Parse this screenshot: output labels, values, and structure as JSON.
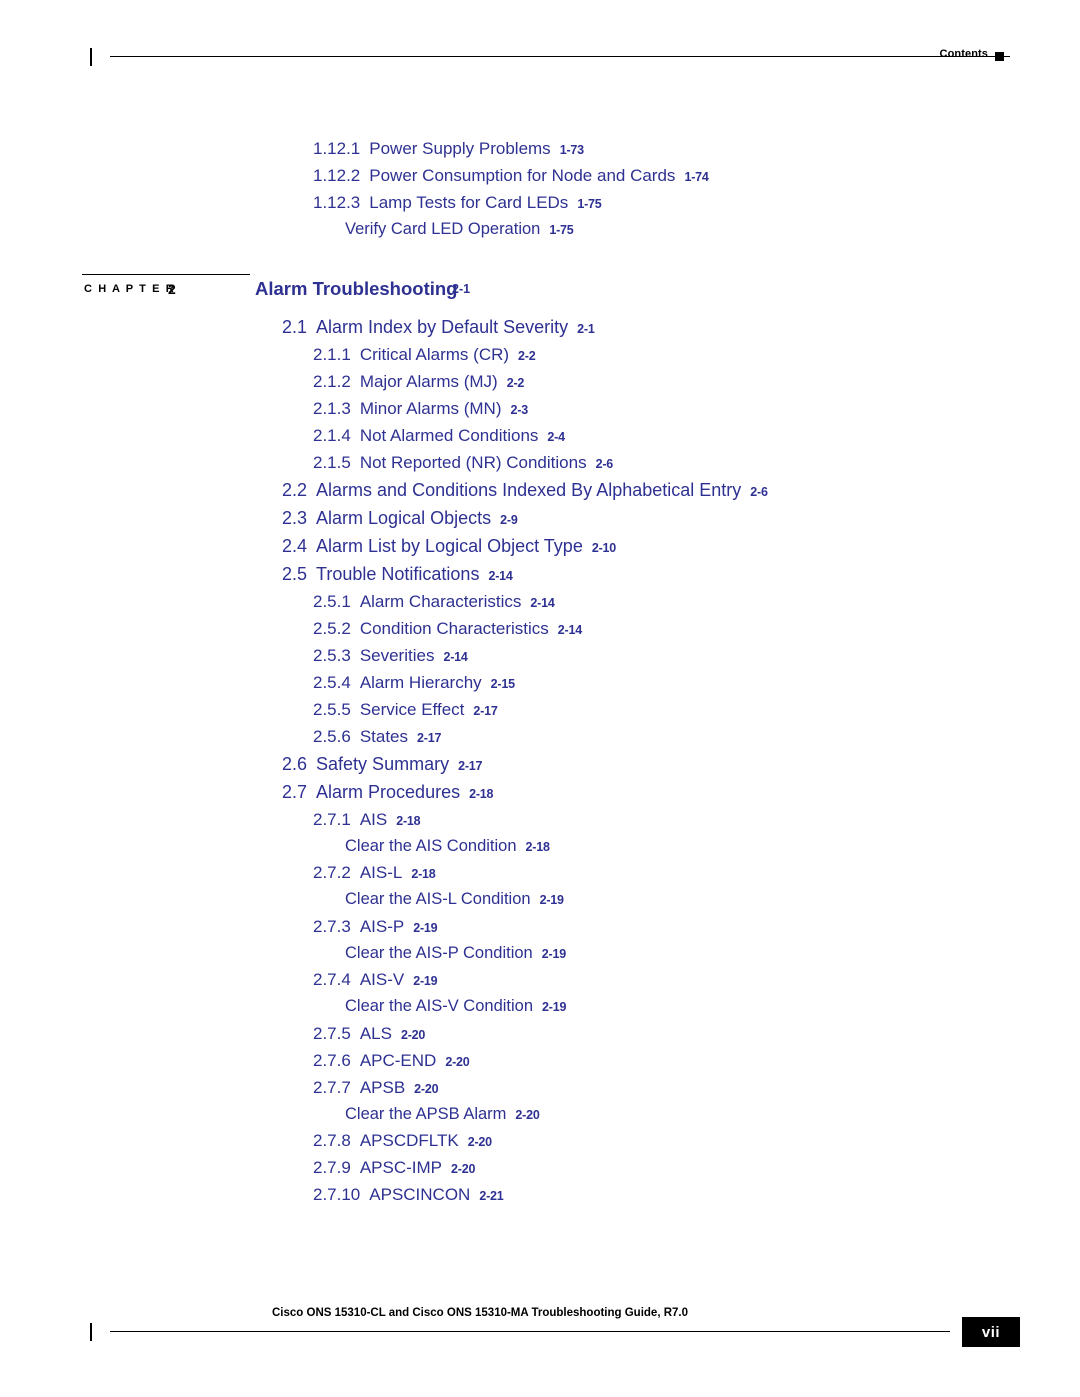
{
  "header": {
    "label": "Contents"
  },
  "footer": {
    "text": "Cisco ONS 15310-CL and Cisco ONS 15310-MA Troubleshooting Guide, R7.0",
    "page_number": "vii"
  },
  "chapter": {
    "word": "C H A P T E R",
    "number": "2",
    "title": "Alarm Troubleshooting",
    "page": "2-1"
  },
  "toc_before": [
    {
      "num": "1.12.1",
      "title": "Power Supply Problems",
      "page": "1-73",
      "level": 2
    },
    {
      "num": "1.12.2",
      "title": "Power Consumption for Node and Cards",
      "page": "1-74",
      "level": 2
    },
    {
      "num": "1.12.3",
      "title": "Lamp Tests for Card LEDs",
      "page": "1-75",
      "level": 2
    },
    {
      "num": "",
      "title": "Verify Card LED Operation",
      "page": "1-75",
      "level": 3
    }
  ],
  "toc_after": [
    {
      "num": "2.1",
      "title": "Alarm Index by Default Severity",
      "page": "2-1",
      "level": 1
    },
    {
      "num": "2.1.1",
      "title": "Critical Alarms (CR)",
      "page": "2-2",
      "level": 2
    },
    {
      "num": "2.1.2",
      "title": "Major Alarms (MJ)",
      "page": "2-2",
      "level": 2
    },
    {
      "num": "2.1.3",
      "title": "Minor Alarms (MN)",
      "page": "2-3",
      "level": 2
    },
    {
      "num": "2.1.4",
      "title": "Not Alarmed Conditions",
      "page": "2-4",
      "level": 2
    },
    {
      "num": "2.1.5",
      "title": "Not Reported (NR) Conditions",
      "page": "2-6",
      "level": 2
    },
    {
      "num": "2.2",
      "title": "Alarms and Conditions Indexed By Alphabetical Entry",
      "page": "2-6",
      "level": 1
    },
    {
      "num": "2.3",
      "title": "Alarm Logical Objects",
      "page": "2-9",
      "level": 1
    },
    {
      "num": "2.4",
      "title": "Alarm List by Logical Object Type",
      "page": "2-10",
      "level": 1
    },
    {
      "num": "2.5",
      "title": "Trouble Notifications",
      "page": "2-14",
      "level": 1
    },
    {
      "num": "2.5.1",
      "title": "Alarm Characteristics",
      "page": "2-14",
      "level": 2
    },
    {
      "num": "2.5.2",
      "title": "Condition Characteristics",
      "page": "2-14",
      "level": 2
    },
    {
      "num": "2.5.3",
      "title": "Severities",
      "page": "2-14",
      "level": 2
    },
    {
      "num": "2.5.4",
      "title": "Alarm Hierarchy",
      "page": "2-15",
      "level": 2
    },
    {
      "num": "2.5.5",
      "title": "Service Effect",
      "page": "2-17",
      "level": 2
    },
    {
      "num": "2.5.6",
      "title": "States",
      "page": "2-17",
      "level": 2
    },
    {
      "num": "2.6",
      "title": "Safety Summary",
      "page": "2-17",
      "level": 1
    },
    {
      "num": "2.7",
      "title": "Alarm Procedures",
      "page": "2-18",
      "level": 1
    },
    {
      "num": "2.7.1",
      "title": "AIS",
      "page": "2-18",
      "level": 2
    },
    {
      "num": "",
      "title": "Clear the AIS Condition",
      "page": "2-18",
      "level": 3
    },
    {
      "num": "2.7.2",
      "title": "AIS-L",
      "page": "2-18",
      "level": 2
    },
    {
      "num": "",
      "title": "Clear the AIS-L Condition",
      "page": "2-19",
      "level": 3
    },
    {
      "num": "2.7.3",
      "title": "AIS-P",
      "page": "2-19",
      "level": 2
    },
    {
      "num": "",
      "title": "Clear the AIS-P Condition",
      "page": "2-19",
      "level": 3
    },
    {
      "num": "2.7.4",
      "title": "AIS-V",
      "page": "2-19",
      "level": 2
    },
    {
      "num": "",
      "title": "Clear the AIS-V Condition",
      "page": "2-19",
      "level": 3
    },
    {
      "num": "2.7.5",
      "title": "ALS",
      "page": "2-20",
      "level": 2
    },
    {
      "num": "2.7.6",
      "title": "APC-END",
      "page": "2-20",
      "level": 2
    },
    {
      "num": "2.7.7",
      "title": "APSB",
      "page": "2-20",
      "level": 2
    },
    {
      "num": "",
      "title": "Clear the APSB Alarm",
      "page": "2-20",
      "level": 3
    },
    {
      "num": "2.7.8",
      "title": "APSCDFLTK",
      "page": "2-20",
      "level": 2
    },
    {
      "num": "2.7.9",
      "title": "APSC-IMP",
      "page": "2-20",
      "level": 2
    },
    {
      "num": "2.7.10",
      "title": "APSCINCON",
      "page": "2-21",
      "level": 2
    }
  ]
}
